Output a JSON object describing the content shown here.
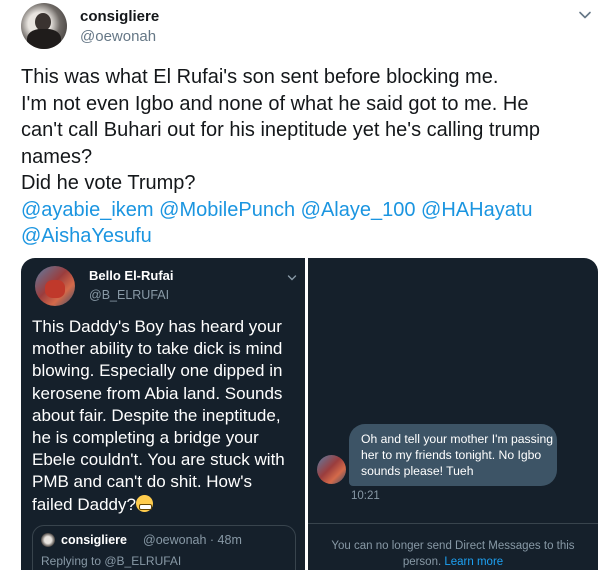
{
  "tweet": {
    "display_name": "consigliere",
    "handle": "@oewonah",
    "text_lines": [
      "This was what El Rufai's son sent before blocking me.",
      "I'm not even Igbo and none of what he said got to me. He",
      "can't call Buhari out for his ineptitude yet he's calling trump",
      "names?",
      "Did he vote Trump?"
    ],
    "mentions": [
      "@ayabie_ikem",
      "@MobilePunch",
      "@Alaye_100",
      "@HAHayatu",
      "@AishaYesufu"
    ],
    "more_icon": "chevron-down-icon"
  },
  "screenshot_left": {
    "display_name": "Bello El-Rufai",
    "handle": "@B_ELRUFAI",
    "text_lines": [
      "This Daddy's Boy has heard your",
      "mother ability to take dick is mind",
      "blowing. Especially one dipped in",
      "kerosene from Abia land. Sounds",
      "about fair. Despite the ineptitude,",
      "he is completing a bridge your",
      "Ebele couldn't. You are stuck with",
      "PMB and can't do shit. How's",
      "failed Daddy?"
    ],
    "emoji": "grimacing-face-emoji",
    "quoted": {
      "display_name": "consigliere",
      "handle_time": "@oewonah · 48m",
      "replying_to": "Replying to @B_ELRUFAI"
    }
  },
  "screenshot_right": {
    "message_lines": [
      "Oh and tell your mother I'm passing",
      "her to my friends tonight. No Igbo",
      "sounds please! Tueh"
    ],
    "time": "10:21",
    "notice_line1": "You can no longer send Direct Messages to this",
    "notice_line2_prefix": "person.",
    "notice_link": "Learn more"
  },
  "colors": {
    "mention": "#1b95e0",
    "dark_bg": "#15202b",
    "bubble": "#3d5466",
    "link": "#1da1f2"
  }
}
